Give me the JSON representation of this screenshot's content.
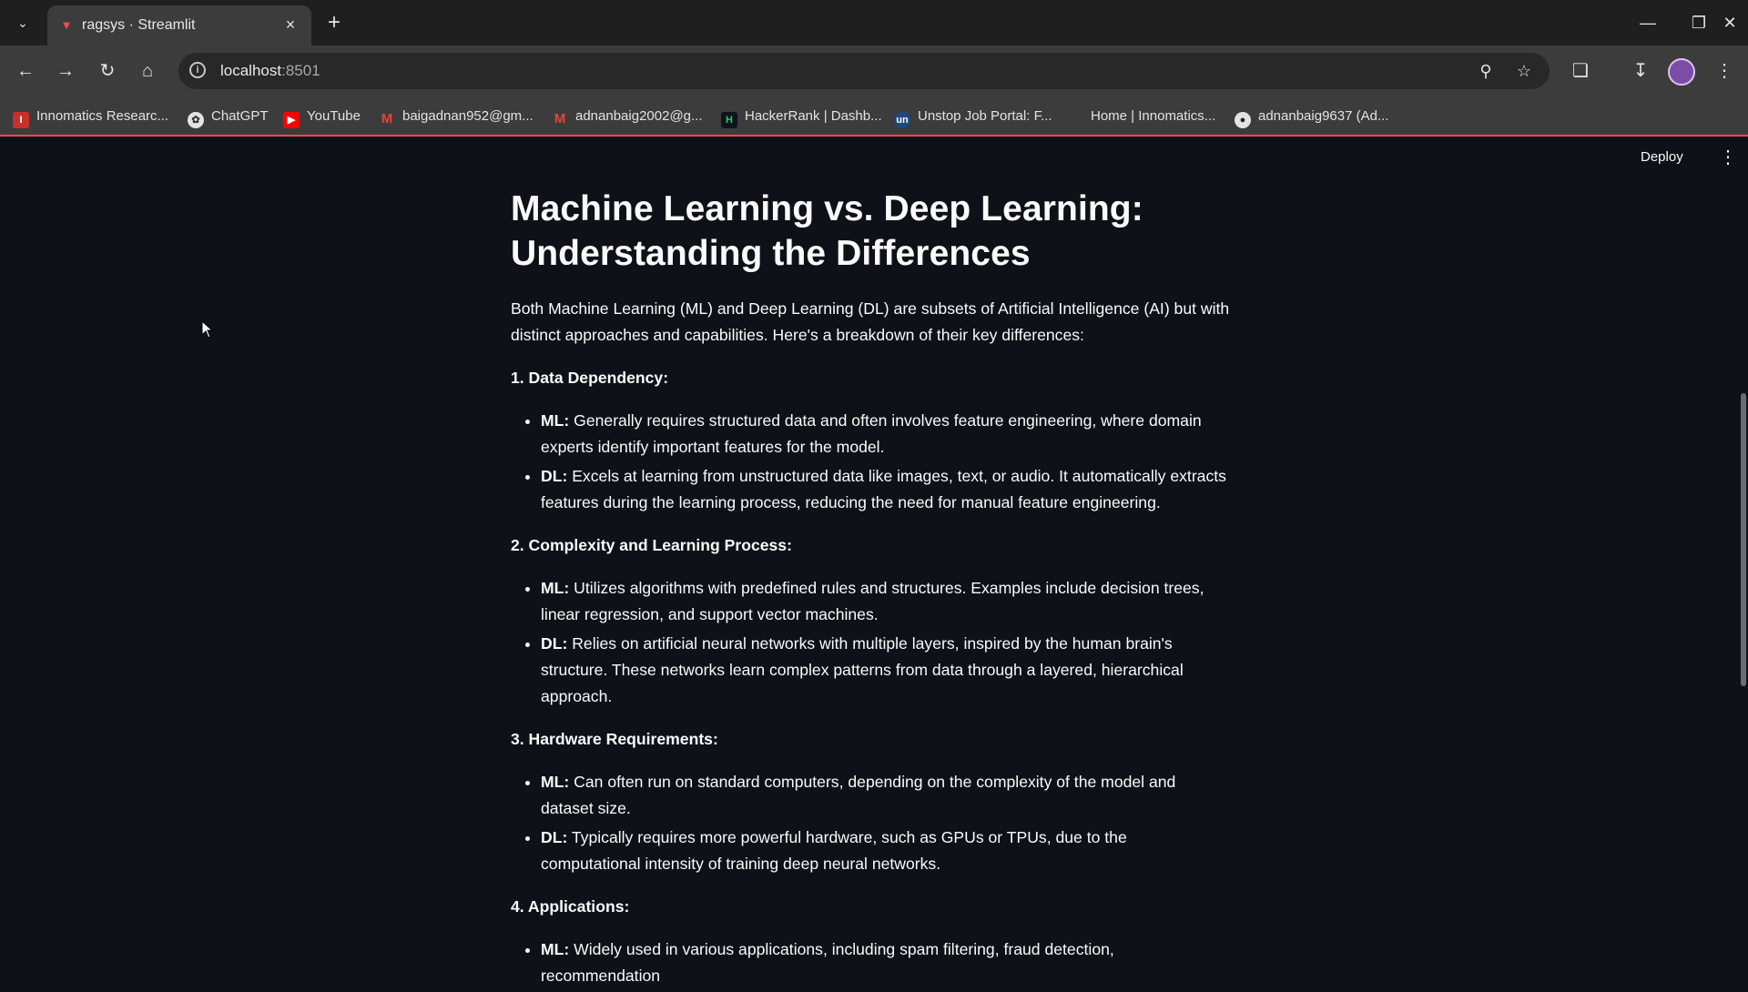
{
  "browser": {
    "tab_title": "ragsys · Streamlit",
    "url_host": "localhost",
    "url_port": ":8501",
    "bookmarks": [
      {
        "label": "Innomatics Researc...",
        "icon": "innomatics-icon"
      },
      {
        "label": "ChatGPT",
        "icon": "chatgpt-icon"
      },
      {
        "label": "YouTube",
        "icon": "youtube-icon"
      },
      {
        "label": "baigadnan952@gm...",
        "icon": "gmail-icon"
      },
      {
        "label": "adnanbaig2002@g...",
        "icon": "gmail-icon"
      },
      {
        "label": "HackerRank | Dashb...",
        "icon": "hackerrank-icon"
      },
      {
        "label": "Unstop Job Portal: F...",
        "icon": "unstop-icon"
      },
      {
        "label": "Home | Innomatics...",
        "icon": "blank-icon"
      },
      {
        "label": "adnanbaig9637 (Ad...",
        "icon": "github-icon"
      }
    ]
  },
  "streamlit": {
    "deploy_label": "Deploy"
  },
  "article": {
    "title": "Machine Learning vs. Deep Learning: Understanding the Differences",
    "intro": "Both Machine Learning (ML) and Deep Learning (DL) are subsets of Artificial Intelligence (AI) but with distinct approaches and capabilities. Here's a breakdown of their key differences:",
    "sections": [
      {
        "heading": "1. Data Dependency:",
        "items": [
          {
            "label": "ML:",
            "text": " Generally requires structured data and often involves feature engineering, where domain experts identify important features for the model."
          },
          {
            "label": "DL:",
            "text": " Excels at learning from unstructured data like images, text, or audio. It automatically extracts features during the learning process, reducing the need for manual feature engineering."
          }
        ]
      },
      {
        "heading": "2. Complexity and Learning Process:",
        "items": [
          {
            "label": "ML:",
            "text": " Utilizes algorithms with predefined rules and structures. Examples include decision trees, linear regression, and support vector machines."
          },
          {
            "label": "DL:",
            "text": " Relies on artificial neural networks with multiple layers, inspired by the human brain's structure. These networks learn complex patterns from data through a layered, hierarchical approach."
          }
        ]
      },
      {
        "heading": "3. Hardware Requirements:",
        "items": [
          {
            "label": "ML:",
            "text": " Can often run on standard computers, depending on the complexity of the model and dataset size."
          },
          {
            "label": "DL:",
            "text": " Typically requires more powerful hardware, such as GPUs or TPUs, due to the computational intensity of training deep neural networks."
          }
        ]
      },
      {
        "heading": "4. Applications:",
        "items": [
          {
            "label": "ML:",
            "text": " Widely used in various applications, including spam filtering, fraud detection, recommendation"
          }
        ]
      }
    ]
  },
  "colors": {
    "background": "#0e1117",
    "text": "#fafafa",
    "accent": "#ff4b4b"
  }
}
